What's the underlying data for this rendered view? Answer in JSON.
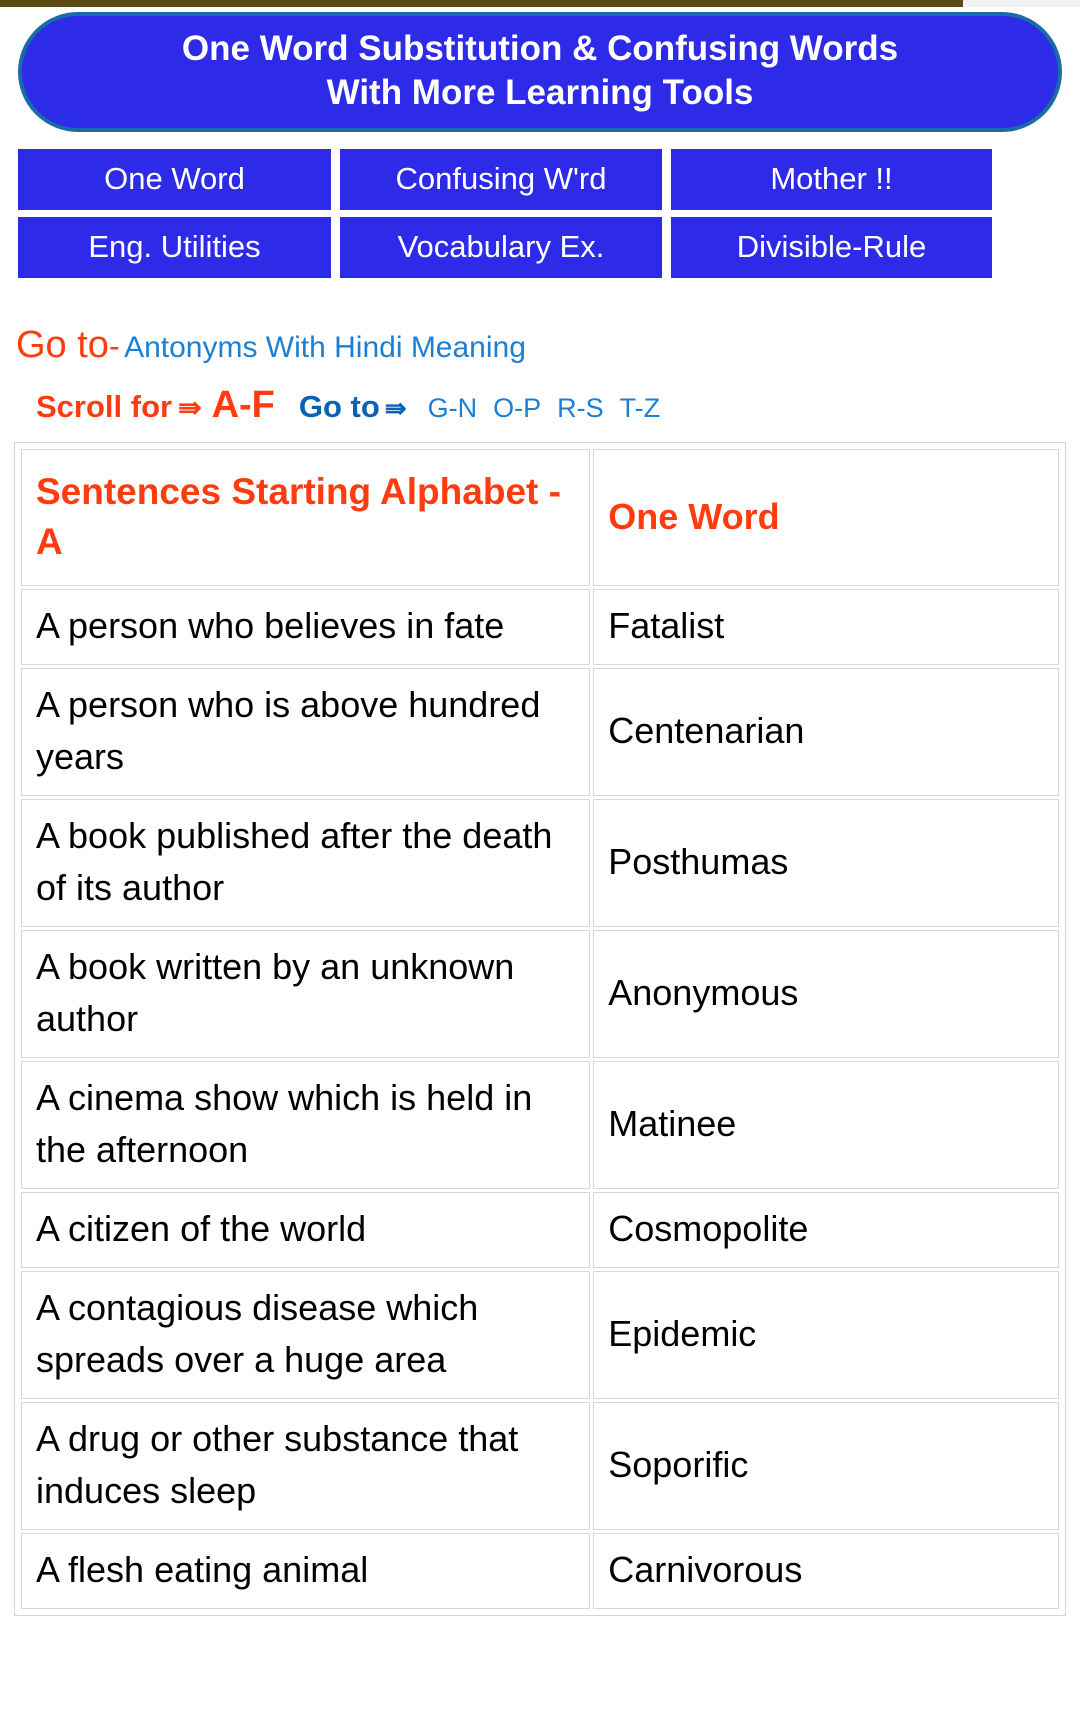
{
  "banner": {
    "line1": "One Word Substitution & Confusing Words",
    "line2": "With More Learning Tools"
  },
  "nav_buttons": [
    {
      "label": "One Word"
    },
    {
      "label": "Confusing W'rd"
    },
    {
      "label": "Mother !!"
    },
    {
      "label": "Eng. Utilities"
    },
    {
      "label": "Vocabulary Ex."
    },
    {
      "label": "Divisible-Rule"
    }
  ],
  "goto_row": {
    "prefix": "Go to",
    "dash": "-",
    "link": "Antonyms With Hindi Meaning"
  },
  "scroll_row": {
    "scroll_label": "Scroll for",
    "arrow1": "⇛",
    "current_range": "A-F",
    "goto_label": "Go to",
    "arrow2": "⇛",
    "ranges": [
      "G-N",
      "O-P",
      "R-S",
      "T-Z"
    ]
  },
  "table": {
    "header": {
      "col1": "Sentences Starting Alphabet - A",
      "col2": "One Word"
    },
    "rows": [
      {
        "sentence": "A person who believes in fate",
        "word": "Fatalist"
      },
      {
        "sentence": "A person who is above hundred years",
        "word": "Centenarian"
      },
      {
        "sentence": "A book published after the death of its author",
        "word": "Posthumas"
      },
      {
        "sentence": "A book written by an unknown author",
        "word": "Anonymous"
      },
      {
        "sentence": "A cinema show which is held in the afternoon",
        "word": "Matinee"
      },
      {
        "sentence": "A citizen of the world",
        "word": "Cosmopolite"
      },
      {
        "sentence": "A contagious disease which spreads over a huge area",
        "word": "Epidemic"
      },
      {
        "sentence": "A drug or other substance that induces sleep",
        "word": "Soporific"
      },
      {
        "sentence": "A flesh eating animal",
        "word": "Carnivorous"
      }
    ]
  },
  "colors": {
    "brand_blue": "#2d2be8",
    "banner_border": "#1a6ca6",
    "accent_red": "#ff3b0f",
    "link_blue": "#1b7fd4",
    "goto_blue": "#0a62b5",
    "table_border": "#d8d8d8",
    "top_strip": "#5c4a16"
  }
}
